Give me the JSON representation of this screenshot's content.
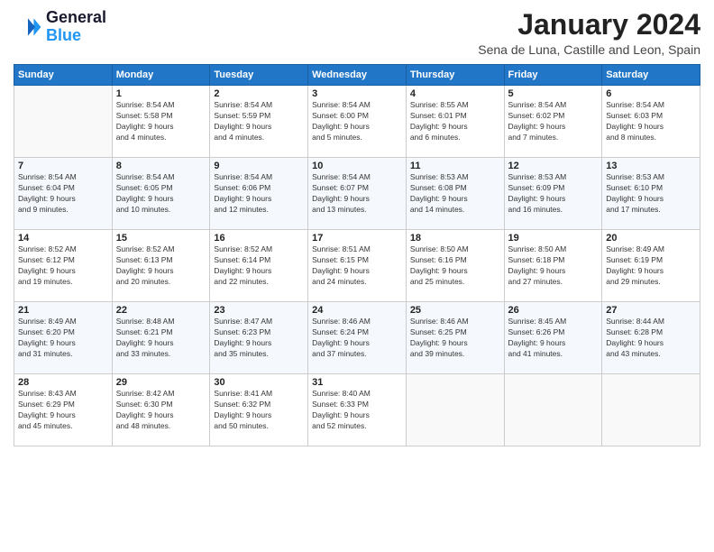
{
  "logo": {
    "line1": "General",
    "line2": "Blue"
  },
  "title": "January 2024",
  "location": "Sena de Luna, Castille and Leon, Spain",
  "days_of_week": [
    "Sunday",
    "Monday",
    "Tuesday",
    "Wednesday",
    "Thursday",
    "Friday",
    "Saturday"
  ],
  "weeks": [
    [
      {
        "day": "",
        "info": ""
      },
      {
        "day": "1",
        "info": "Sunrise: 8:54 AM\nSunset: 5:58 PM\nDaylight: 9 hours\nand 4 minutes."
      },
      {
        "day": "2",
        "info": "Sunrise: 8:54 AM\nSunset: 5:59 PM\nDaylight: 9 hours\nand 4 minutes."
      },
      {
        "day": "3",
        "info": "Sunrise: 8:54 AM\nSunset: 6:00 PM\nDaylight: 9 hours\nand 5 minutes."
      },
      {
        "day": "4",
        "info": "Sunrise: 8:55 AM\nSunset: 6:01 PM\nDaylight: 9 hours\nand 6 minutes."
      },
      {
        "day": "5",
        "info": "Sunrise: 8:54 AM\nSunset: 6:02 PM\nDaylight: 9 hours\nand 7 minutes."
      },
      {
        "day": "6",
        "info": "Sunrise: 8:54 AM\nSunset: 6:03 PM\nDaylight: 9 hours\nand 8 minutes."
      }
    ],
    [
      {
        "day": "7",
        "info": "Sunrise: 8:54 AM\nSunset: 6:04 PM\nDaylight: 9 hours\nand 9 minutes."
      },
      {
        "day": "8",
        "info": "Sunrise: 8:54 AM\nSunset: 6:05 PM\nDaylight: 9 hours\nand 10 minutes."
      },
      {
        "day": "9",
        "info": "Sunrise: 8:54 AM\nSunset: 6:06 PM\nDaylight: 9 hours\nand 12 minutes."
      },
      {
        "day": "10",
        "info": "Sunrise: 8:54 AM\nSunset: 6:07 PM\nDaylight: 9 hours\nand 13 minutes."
      },
      {
        "day": "11",
        "info": "Sunrise: 8:53 AM\nSunset: 6:08 PM\nDaylight: 9 hours\nand 14 minutes."
      },
      {
        "day": "12",
        "info": "Sunrise: 8:53 AM\nSunset: 6:09 PM\nDaylight: 9 hours\nand 16 minutes."
      },
      {
        "day": "13",
        "info": "Sunrise: 8:53 AM\nSunset: 6:10 PM\nDaylight: 9 hours\nand 17 minutes."
      }
    ],
    [
      {
        "day": "14",
        "info": "Sunrise: 8:52 AM\nSunset: 6:12 PM\nDaylight: 9 hours\nand 19 minutes."
      },
      {
        "day": "15",
        "info": "Sunrise: 8:52 AM\nSunset: 6:13 PM\nDaylight: 9 hours\nand 20 minutes."
      },
      {
        "day": "16",
        "info": "Sunrise: 8:52 AM\nSunset: 6:14 PM\nDaylight: 9 hours\nand 22 minutes."
      },
      {
        "day": "17",
        "info": "Sunrise: 8:51 AM\nSunset: 6:15 PM\nDaylight: 9 hours\nand 24 minutes."
      },
      {
        "day": "18",
        "info": "Sunrise: 8:50 AM\nSunset: 6:16 PM\nDaylight: 9 hours\nand 25 minutes."
      },
      {
        "day": "19",
        "info": "Sunrise: 8:50 AM\nSunset: 6:18 PM\nDaylight: 9 hours\nand 27 minutes."
      },
      {
        "day": "20",
        "info": "Sunrise: 8:49 AM\nSunset: 6:19 PM\nDaylight: 9 hours\nand 29 minutes."
      }
    ],
    [
      {
        "day": "21",
        "info": "Sunrise: 8:49 AM\nSunset: 6:20 PM\nDaylight: 9 hours\nand 31 minutes."
      },
      {
        "day": "22",
        "info": "Sunrise: 8:48 AM\nSunset: 6:21 PM\nDaylight: 9 hours\nand 33 minutes."
      },
      {
        "day": "23",
        "info": "Sunrise: 8:47 AM\nSunset: 6:23 PM\nDaylight: 9 hours\nand 35 minutes."
      },
      {
        "day": "24",
        "info": "Sunrise: 8:46 AM\nSunset: 6:24 PM\nDaylight: 9 hours\nand 37 minutes."
      },
      {
        "day": "25",
        "info": "Sunrise: 8:46 AM\nSunset: 6:25 PM\nDaylight: 9 hours\nand 39 minutes."
      },
      {
        "day": "26",
        "info": "Sunrise: 8:45 AM\nSunset: 6:26 PM\nDaylight: 9 hours\nand 41 minutes."
      },
      {
        "day": "27",
        "info": "Sunrise: 8:44 AM\nSunset: 6:28 PM\nDaylight: 9 hours\nand 43 minutes."
      }
    ],
    [
      {
        "day": "28",
        "info": "Sunrise: 8:43 AM\nSunset: 6:29 PM\nDaylight: 9 hours\nand 45 minutes."
      },
      {
        "day": "29",
        "info": "Sunrise: 8:42 AM\nSunset: 6:30 PM\nDaylight: 9 hours\nand 48 minutes."
      },
      {
        "day": "30",
        "info": "Sunrise: 8:41 AM\nSunset: 6:32 PM\nDaylight: 9 hours\nand 50 minutes."
      },
      {
        "day": "31",
        "info": "Sunrise: 8:40 AM\nSunset: 6:33 PM\nDaylight: 9 hours\nand 52 minutes."
      },
      {
        "day": "",
        "info": ""
      },
      {
        "day": "",
        "info": ""
      },
      {
        "day": "",
        "info": ""
      }
    ]
  ]
}
